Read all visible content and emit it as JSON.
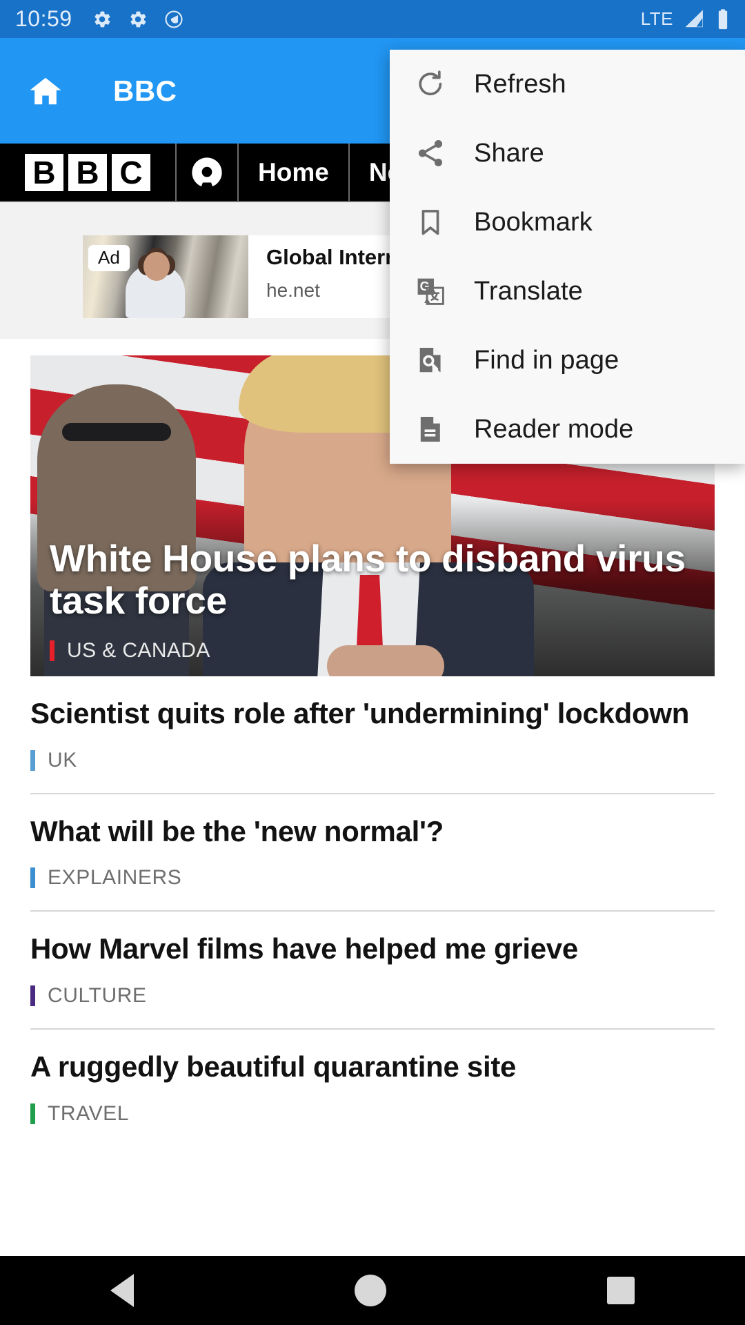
{
  "status_bar": {
    "time": "10:59",
    "icons": [
      "gear-icon",
      "gear-icon",
      "quick-settings-icon"
    ],
    "network": "LTE",
    "signal_icon": "signal-triangle-icon",
    "battery_icon": "battery-full-icon"
  },
  "app_bar": {
    "home_icon": "home-icon",
    "title": "BBC"
  },
  "site_nav": {
    "logo_letters": [
      "B",
      "B",
      "C"
    ],
    "account_icon": "account-circle-icon",
    "items": [
      {
        "label": "Home"
      },
      {
        "label": "News"
      }
    ]
  },
  "advertisement": {
    "badge": "Ad",
    "title": "Global Internet",
    "url": "he.net"
  },
  "hero": {
    "title": "White House plans to disband virus task force",
    "category": "US & CANADA",
    "category_color": "#e8202a"
  },
  "stories": [
    {
      "title": "Scientist quits role after 'undermining' lockdown",
      "category": "UK",
      "category_color": "#5a9fd4"
    },
    {
      "title": "What will be the 'new normal'?",
      "category": "EXPLAINERS",
      "category_color": "#3b8ed0"
    },
    {
      "title": "How Marvel films have helped me grieve",
      "category": "CULTURE",
      "category_color": "#4b2a82"
    },
    {
      "title": "A ruggedly beautiful quarantine site",
      "category": "TRAVEL",
      "category_color": "#1f9e4b"
    }
  ],
  "overflow_menu": {
    "items": [
      {
        "label": "Refresh",
        "icon": "refresh-icon"
      },
      {
        "label": "Share",
        "icon": "share-icon"
      },
      {
        "label": "Bookmark",
        "icon": "bookmark-icon"
      },
      {
        "label": "Translate",
        "icon": "translate-icon"
      },
      {
        "label": "Find in page",
        "icon": "find-in-page-icon"
      },
      {
        "label": "Reader mode",
        "icon": "reader-mode-icon"
      }
    ]
  },
  "system_nav": {
    "back": "back-triangle-icon",
    "home": "home-circle-icon",
    "recents": "recents-square-icon"
  },
  "colors": {
    "status_bar": "#1872c8",
    "app_bar": "#2196f3",
    "menu_bg": "#f8f8f8",
    "icon_gray": "#6e6e6e"
  }
}
